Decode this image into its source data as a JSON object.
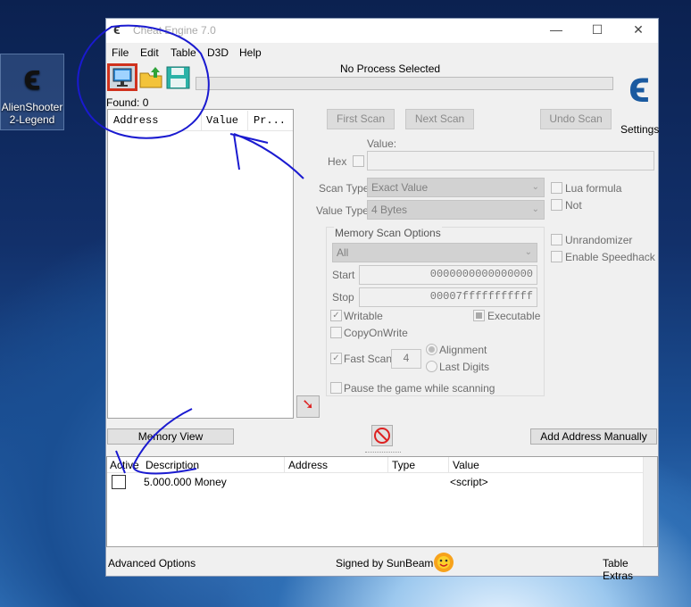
{
  "desktop": {
    "icon_label_1": "AlienShooter",
    "icon_label_2": "2-Legend"
  },
  "window": {
    "title": "Cheat Engine 7.0",
    "controls": {
      "minimize": "—",
      "maximize": "☐",
      "close": "✕"
    }
  },
  "menu": [
    "File",
    "Edit",
    "Table",
    "D3D",
    "Help"
  ],
  "toolbar": {
    "process_label": "No Process Selected",
    "settings_label": "Settings"
  },
  "found": "Found: 0",
  "results_columns": [
    "Address",
    "Value",
    "Pr..."
  ],
  "scan_buttons": {
    "first": "First Scan",
    "next": "Next Scan",
    "undo": "Undo Scan"
  },
  "value": {
    "label": "Value:",
    "hex_label": "Hex",
    "input": ""
  },
  "scan_type": {
    "label": "Scan Type",
    "selected": "Exact Value"
  },
  "value_type": {
    "label": "Value Type",
    "selected": "4 Bytes"
  },
  "options_right": {
    "lua": "Lua formula",
    "not": "Not",
    "unrandomizer": "Unrandomizer",
    "speedhack": "Enable Speedhack"
  },
  "memory_scan": {
    "title": "Memory Scan Options",
    "region": "All",
    "start_label": "Start",
    "start": "0000000000000000",
    "stop_label": "Stop",
    "stop": "00007fffffffffff",
    "writable": "Writable",
    "executable": "Executable",
    "copyonwrite": "CopyOnWrite",
    "fastscan": "Fast Scan",
    "fastscan_value": "4",
    "alignment": "Alignment",
    "lastdigits": "Last Digits",
    "pause": "Pause the game while scanning"
  },
  "memory_view": "Memory View",
  "add_address": "Add Address Manually",
  "table_columns": [
    "Active",
    "Description",
    "Address",
    "Type",
    "Value"
  ],
  "table_rows": [
    {
      "description": "5.000.000 Money",
      "address": "",
      "type": "",
      "value": "<script>"
    }
  ],
  "footer": {
    "advanced": "Advanced Options",
    "signed": "Signed by SunBeam",
    "extras": "Table Extras"
  }
}
